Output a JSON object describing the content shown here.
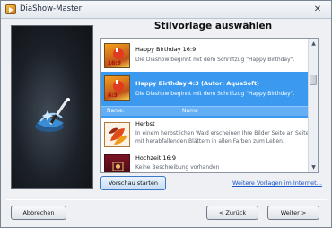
{
  "window": {
    "title": "DiaShow-Master"
  },
  "icons": {
    "app": "app-icon",
    "close": "close-icon",
    "magic": "magic-wand-icon"
  },
  "heading": "Stilvorlage auswählen",
  "templates": [
    {
      "title": "Happy Birthday 16:9",
      "description": "Die Diashow beginnt mit dem Schriftzug \"Happy Birthday\".",
      "selected": false,
      "thumb_label": "16:9"
    },
    {
      "title": "Happy Birthday 4:3 (Autor: AquaSoft)",
      "description": "Die Diashow beginnt mit dem Schriftzug \"Happy Birthday\".",
      "selected": true,
      "thumb_label": "4:3"
    },
    {
      "title": "Herbst",
      "description_line1": "In einem herbstlichen Wald erscheinen Ihre Bilder Seite an Seite",
      "description_line2": "mit herabfallenden Blättern in allen Farben zum Leben.",
      "selected": false
    },
    {
      "title": "Hochzeit 16:9",
      "description": "Keine Beschreibung vorhanden",
      "selected": false
    }
  ],
  "detail_row": {
    "label": "Name:",
    "value": "Name"
  },
  "buttons": {
    "preview": "Vorschau starten",
    "more_templates_link": "Weitere Vorlagen im Internet...",
    "cancel": "Abbrechen",
    "back": "< Zurück",
    "next": "Weiter >"
  },
  "colors": {
    "selection": "#3b9af0",
    "link": "#1a56c8"
  }
}
